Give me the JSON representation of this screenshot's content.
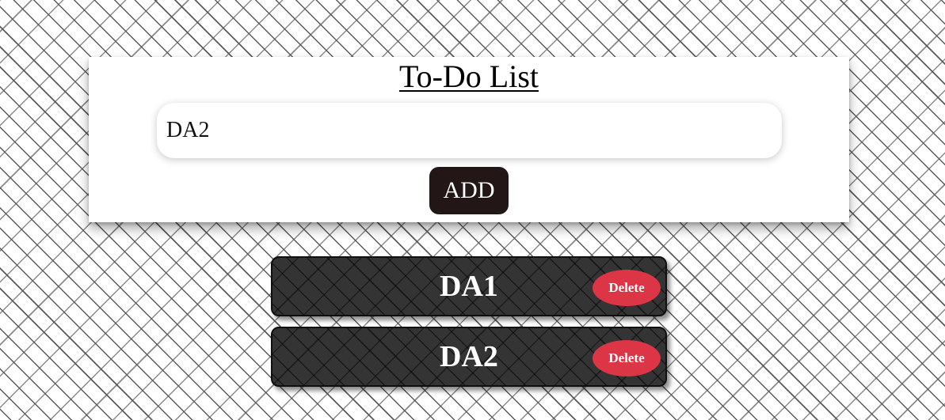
{
  "header": {
    "title": "To-Do List"
  },
  "input": {
    "value": "DA2",
    "placeholder": ""
  },
  "add_button": {
    "label": "ADD"
  },
  "colors": {
    "add_button_bg": "#221616",
    "item_bg": "#343434",
    "delete_bg": "#dc3545"
  },
  "tasks": [
    {
      "text": "DA1",
      "delete_label": "Delete"
    },
    {
      "text": "DA2",
      "delete_label": "Delete"
    }
  ]
}
